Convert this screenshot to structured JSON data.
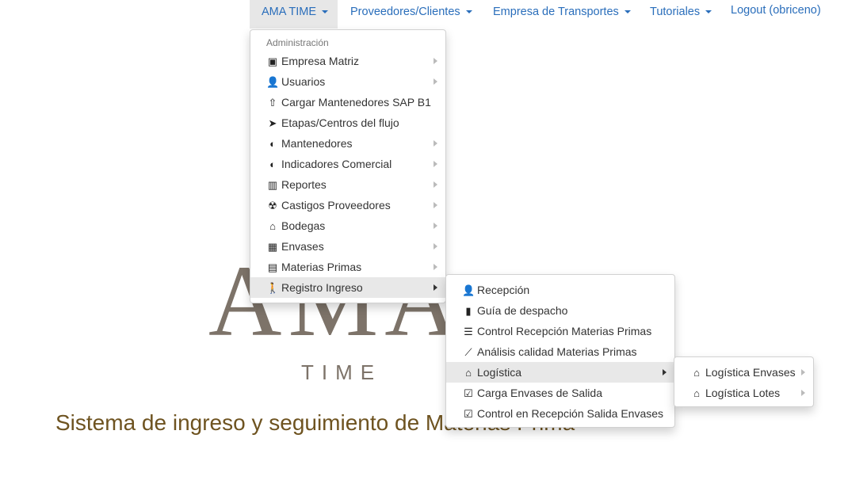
{
  "nav": {
    "items": [
      {
        "label": "AMA TIME"
      },
      {
        "label": "Proveedores/Clientes"
      },
      {
        "label": "Empresa de Transportes"
      },
      {
        "label": "Tutoriales"
      }
    ],
    "logout": "Logout (obriceno)"
  },
  "brand": {
    "letters": "AMA",
    "time": "TIME",
    "tagline": "Sistema de ingreso y seguimiento de Materias Prima"
  },
  "menu": {
    "header": "Administración",
    "items": [
      {
        "label": "Empresa Matriz",
        "icon": "id-badge-icon"
      },
      {
        "label": "Usuarios",
        "icon": "user-cog-icon"
      },
      {
        "label": "Cargar Mantenedores SAP B1",
        "icon": "upload-icon"
      },
      {
        "label": "Etapas/Centros del flujo",
        "icon": "paper-plane-icon"
      },
      {
        "label": "Mantenedores",
        "icon": "toggle-icon"
      },
      {
        "label": "Indicadores Comercial",
        "icon": "toggle-icon"
      },
      {
        "label": "Reportes",
        "icon": "bar-chart-icon"
      },
      {
        "label": "Castigos Proveedores",
        "icon": "radiation-icon"
      },
      {
        "label": "Bodegas",
        "icon": "warehouse-icon"
      },
      {
        "label": "Envases",
        "icon": "boxes-icon"
      },
      {
        "label": "Materias Primas",
        "icon": "pallet-icon"
      },
      {
        "label": "Registro Ingreso",
        "icon": "walking-icon"
      }
    ]
  },
  "submenu": {
    "items": [
      {
        "label": "Recepción",
        "icon": "user-lock-icon"
      },
      {
        "label": "Guía de despacho",
        "icon": "file-invoice-icon"
      },
      {
        "label": "Control Recepción Materias Primas",
        "icon": "list-icon"
      },
      {
        "label": "Análisis calidad Materias Primas",
        "icon": "line-chart-icon"
      },
      {
        "label": "Logística",
        "icon": "warehouse-icon"
      },
      {
        "label": "Carga Envases de Salida",
        "icon": "clipboard-check-icon"
      },
      {
        "label": "Control en Recepción Salida Envases",
        "icon": "clipboard-check-icon"
      }
    ]
  },
  "submenu2": {
    "items": [
      {
        "label": "Logística Envases",
        "icon": "warehouse-icon"
      },
      {
        "label": "Logística Lotes",
        "icon": "warehouse-icon"
      }
    ]
  }
}
